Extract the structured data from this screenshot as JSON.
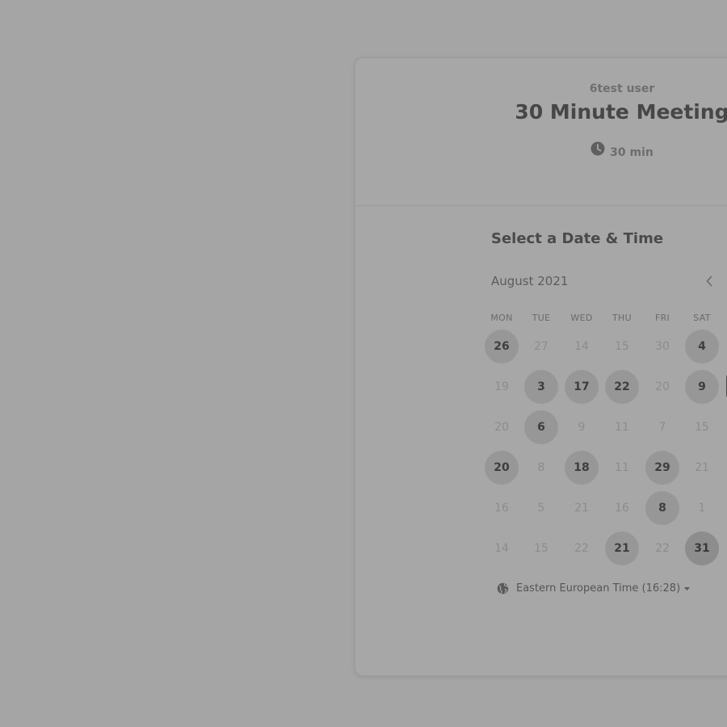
{
  "event": {
    "host": "6test user",
    "title": "30 Minute Meeting",
    "duration": "30 min",
    "duration_icon": "clock-icon"
  },
  "scheduler": {
    "heading": "Select a Date & Time",
    "month_label": "August 2021",
    "prev_icon": "chevron-left-icon",
    "weekdays": [
      "MON",
      "TUE",
      "WED",
      "THU",
      "FRI",
      "SAT"
    ],
    "weeks": [
      [
        {
          "label": "26",
          "available": true
        },
        {
          "label": "27",
          "available": false
        },
        {
          "label": "14",
          "available": false
        },
        {
          "label": "15",
          "available": false
        },
        {
          "label": "30",
          "available": false
        },
        {
          "label": "4",
          "available": true
        }
      ],
      [
        {
          "label": "19",
          "available": false
        },
        {
          "label": "3",
          "available": true
        },
        {
          "label": "17",
          "available": true
        },
        {
          "label": "22",
          "available": true
        },
        {
          "label": "20",
          "available": false
        },
        {
          "label": "9",
          "available": true
        }
      ],
      [
        {
          "label": "20",
          "available": false
        },
        {
          "label": "6",
          "available": true
        },
        {
          "label": "9",
          "available": false
        },
        {
          "label": "11",
          "available": false
        },
        {
          "label": "7",
          "available": false
        },
        {
          "label": "15",
          "available": false
        }
      ],
      [
        {
          "label": "20",
          "available": true
        },
        {
          "label": "8",
          "available": false
        },
        {
          "label": "18",
          "available": true
        },
        {
          "label": "11",
          "available": false
        },
        {
          "label": "29",
          "available": true
        },
        {
          "label": "21",
          "available": false
        }
      ],
      [
        {
          "label": "16",
          "available": false
        },
        {
          "label": "5",
          "available": false
        },
        {
          "label": "21",
          "available": false
        },
        {
          "label": "16",
          "available": false
        },
        {
          "label": "8",
          "available": true
        },
        {
          "label": "1",
          "available": false
        }
      ],
      [
        {
          "label": "14",
          "available": false
        },
        {
          "label": "15",
          "available": false
        },
        {
          "label": "22",
          "available": false
        },
        {
          "label": "21",
          "available": true
        },
        {
          "label": "22",
          "available": false
        },
        {
          "label": "31",
          "available": true,
          "selected": true
        }
      ]
    ],
    "timezone": {
      "label": "Eastern European Time (16:28)",
      "icon": "globe-icon",
      "dropdown_icon": "caret-down-icon"
    }
  },
  "colors": {
    "background": "#a5a5a5",
    "available_day": "#979797",
    "selected_day": "#8d8d8d"
  }
}
